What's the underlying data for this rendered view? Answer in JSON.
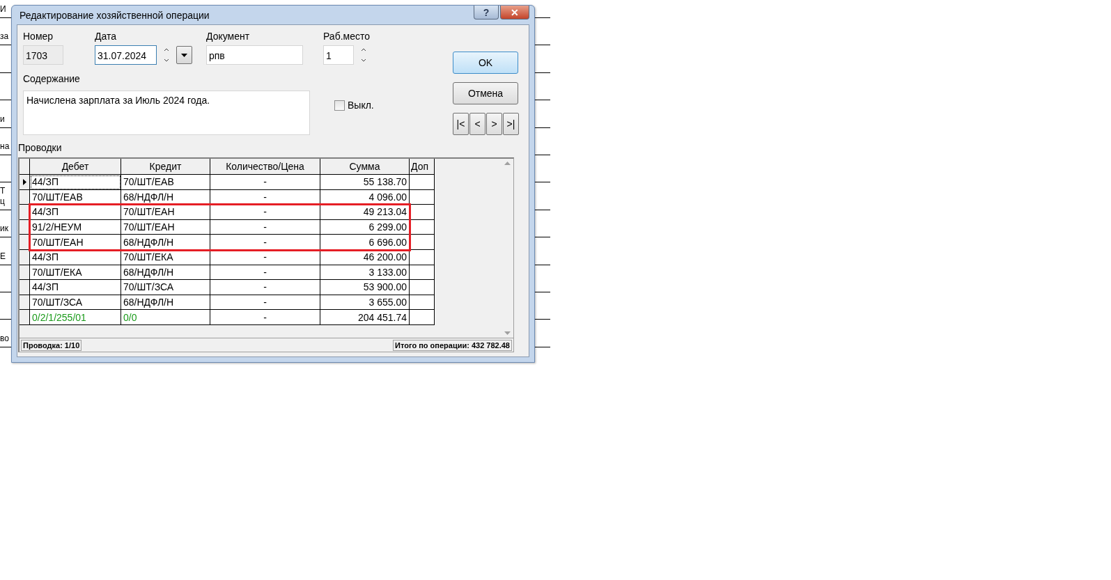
{
  "background": {
    "rows": [
      {
        "texts": [
          "И"
        ]
      },
      {
        "texts": [
          "за"
        ]
      },
      {
        "texts": []
      },
      {
        "texts": []
      },
      {
        "texts": [
          "и"
        ]
      },
      {
        "texts": [
          "на"
        ]
      },
      {
        "texts": []
      },
      {
        "texts": [
          "Т",
          "ц"
        ]
      },
      {
        "texts": [
          "ик"
        ]
      },
      {
        "texts": [
          "Е"
        ]
      },
      {
        "texts": []
      },
      {
        "texts": []
      },
      {
        "texts": [
          "во"
        ]
      }
    ]
  },
  "window": {
    "title": "Редактирование хозяйственной операции",
    "help": "?",
    "close": "✕"
  },
  "form": {
    "number": {
      "label": "Номер",
      "value": "1703",
      "disabled": true
    },
    "date": {
      "label": "Дата",
      "value": "31.07.2024"
    },
    "document": {
      "label": "Документ",
      "value": "рпв"
    },
    "workplace": {
      "label": "Раб.место",
      "value": "1"
    },
    "content": {
      "label": "Содержание",
      "value": "Начислена зарплата за Июль 2024 года."
    },
    "off": {
      "label": "Выкл.",
      "checked": false
    }
  },
  "buttons": {
    "ok": "OK",
    "cancel": "Отмена",
    "nav": [
      "|<",
      "<",
      ">",
      ">|"
    ]
  },
  "entries": {
    "label": "Проводки",
    "columns": [
      "Дебет",
      "Кредит",
      "Количество/Цена",
      "Сумма",
      "Доп"
    ],
    "rows": [
      {
        "kind": "entry",
        "selected": true,
        "outlined": false,
        "cells": [
          "44/ЗП",
          "70/ШТ/ЕАВ",
          "-",
          "55 138.70",
          ""
        ]
      },
      {
        "kind": "entry",
        "selected": false,
        "outlined": false,
        "cells": [
          "70/ШТ/ЕАВ",
          "68/НДФЛ/Н",
          "-",
          "4 096.00",
          ""
        ]
      },
      {
        "kind": "entry",
        "selected": false,
        "outlined": true,
        "cells": [
          "44/ЗП",
          "70/ШТ/ЕАН",
          "-",
          "49 213.04",
          ""
        ]
      },
      {
        "kind": "entry",
        "selected": false,
        "outlined": true,
        "cells": [
          "91/2/НЕУМ",
          "70/ШТ/ЕАН",
          "-",
          "6 299.00",
          ""
        ]
      },
      {
        "kind": "entry",
        "selected": false,
        "outlined": true,
        "cells": [
          "70/ШТ/ЕАН",
          "68/НДФЛ/Н",
          "-",
          "6 696.00",
          ""
        ]
      },
      {
        "kind": "entry",
        "selected": false,
        "outlined": false,
        "cells": [
          "44/ЗП",
          "70/ШТ/ЕКА",
          "-",
          "46 200.00",
          ""
        ]
      },
      {
        "kind": "entry",
        "selected": false,
        "outlined": false,
        "cells": [
          "70/ШТ/ЕКА",
          "68/НДФЛ/Н",
          "-",
          "3 133.00",
          ""
        ]
      },
      {
        "kind": "entry",
        "selected": false,
        "outlined": false,
        "cells": [
          "44/ЗП",
          "70/ШТ/ЗСА",
          "-",
          "53 900.00",
          ""
        ]
      },
      {
        "kind": "entry",
        "selected": false,
        "outlined": false,
        "cells": [
          "70/ШТ/ЗСА",
          "68/НДФЛ/Н",
          "-",
          "3 655.00",
          ""
        ]
      },
      {
        "kind": "summary",
        "selected": false,
        "outlined": false,
        "cells": [
          "0/2/1/255/01",
          "0/0",
          "-",
          "204 451.74",
          ""
        ]
      }
    ]
  },
  "status_bar": {
    "position": "Проводка: 1/10",
    "total": "Итого по операции: 432 782.48"
  }
}
